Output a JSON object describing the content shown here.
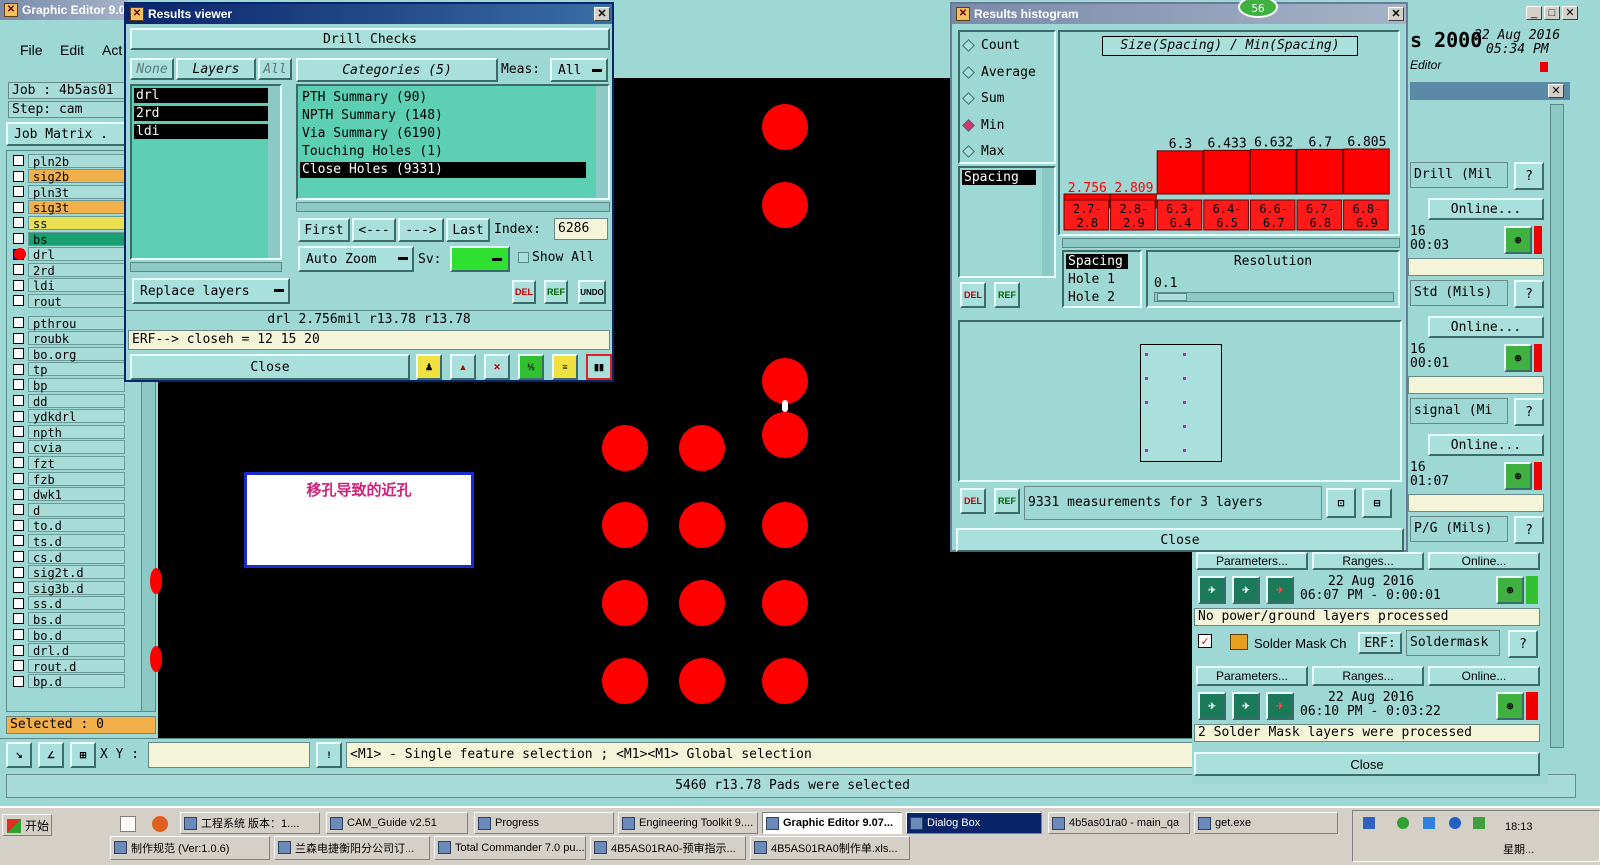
{
  "main_window": {
    "title": "Graphic Editor 9.0",
    "menu": [
      "File",
      "Edit",
      "Act"
    ],
    "job": "Job : 4b5as01",
    "step": "Step: cam",
    "job_matrix": "Job Matrix ."
  },
  "layer_list": [
    {
      "name": "pln2b",
      "color": "#a8dcd8"
    },
    {
      "name": "sig2b",
      "color": "#f2b04a"
    },
    {
      "name": "pln3t",
      "color": "#a8dcd8"
    },
    {
      "name": "sig3t",
      "color": "#f2b04a"
    },
    {
      "name": "ss",
      "color": "#e8e050"
    },
    {
      "name": "bs",
      "color": "#18a070"
    },
    {
      "name": "drl",
      "color": "#a8dcd8"
    },
    {
      "name": "2rd",
      "color": "#a8dcd8"
    },
    {
      "name": "ldi",
      "color": "#a8dcd8"
    },
    {
      "name": "rout",
      "color": "#a8dcd8"
    },
    {
      "name": "pthrou",
      "color": "#a8dcd8"
    },
    {
      "name": "roubk",
      "color": "#a8dcd8"
    },
    {
      "name": "bo.org",
      "color": "#a8dcd8"
    },
    {
      "name": "tp",
      "color": "#a8dcd8"
    },
    {
      "name": "bp",
      "color": "#a8dcd8"
    },
    {
      "name": "dd",
      "color": "#a8dcd8"
    },
    {
      "name": "ydkdrl",
      "color": "#a8dcd8"
    },
    {
      "name": "npth",
      "color": "#a8dcd8"
    },
    {
      "name": "cvia",
      "color": "#a8dcd8"
    },
    {
      "name": "fzt",
      "color": "#a8dcd8"
    },
    {
      "name": "fzb",
      "color": "#a8dcd8"
    },
    {
      "name": "dwk1",
      "color": "#a8dcd8"
    },
    {
      "name": "d",
      "color": "#a8dcd8"
    },
    {
      "name": "to.d",
      "color": "#a8dcd8"
    },
    {
      "name": "ts.d",
      "color": "#a8dcd8"
    },
    {
      "name": "cs.d",
      "color": "#a8dcd8"
    },
    {
      "name": "sig2t.d",
      "color": "#a8dcd8"
    },
    {
      "name": "sig3b.d",
      "color": "#a8dcd8"
    },
    {
      "name": "ss.d",
      "color": "#a8dcd8"
    },
    {
      "name": "bs.d",
      "color": "#a8dcd8"
    },
    {
      "name": "bo.d",
      "color": "#a8dcd8"
    },
    {
      "name": "drl.d",
      "color": "#a8dcd8"
    },
    {
      "name": "rout.d",
      "color": "#a8dcd8"
    },
    {
      "name": "bp.d",
      "color": "#a8dcd8"
    }
  ],
  "selected_count": "Selected : 0",
  "xy_label": "X Y :",
  "status_hint": "<M1> - Single feature selection ; <M1><M1> Global selection",
  "status_bottom": "5460 r13.78 Pads were selected",
  "annotation_text": "移孔导致的近孔",
  "results_viewer": {
    "title": "Results viewer",
    "header": "Drill Checks",
    "layer_filters": [
      "None",
      "Layers",
      "All"
    ],
    "layers": [
      "drl",
      "2rd",
      "ldi"
    ],
    "categories_label": "Categories (5)",
    "meas_label": "Meas:",
    "meas_value": "All",
    "categories": [
      "PTH Summary (90)",
      "NPTH Summary (148)",
      "Via Summary (6190)",
      "Touching Holes (1)",
      "Close Holes (9331)"
    ],
    "selected_category": "Close Holes (9331)",
    "nav": {
      "first": "First",
      "prev": "<---",
      "next": "--->",
      "last": "Last",
      "index_label": "Index:",
      "index_value": "6286"
    },
    "auto_zoom": "Auto Zoom",
    "sv_label": "Sv:",
    "show_all": "Show All",
    "replace_layers": "Replace layers",
    "icon_del": "DEL",
    "icon_ref": "REF",
    "icon_undo": "UNDO",
    "measure_line": "drl 2.756mil   r13.78   r13.78",
    "erf_line": "ERF--> closeh = 12 15 20",
    "close": "Close"
  },
  "histogram": {
    "title": "Results histogram",
    "badge": "56",
    "modes": [
      "Count",
      "Average",
      "Sum",
      "Min",
      "Max"
    ],
    "selected_mode": "Min",
    "list_item": "Spacing",
    "chart_title": "Size(Spacing) / Min(Spacing)",
    "info_items": [
      "Spacing",
      "Hole 1",
      "Hole 2"
    ],
    "resolution_label": "Resolution",
    "resolution_value": "0.1",
    "measurements": "9331 measurements for 3 layers",
    "close": "Close"
  },
  "chart_data": {
    "type": "bar",
    "title": "Size(Spacing) / Min(Spacing)",
    "categories": [
      "2.7-2.8",
      "2.8-2.9",
      "6.3-6.4",
      "6.4-6.5",
      "6.6-6.7",
      "6.7-6.8",
      "6.8-6.9"
    ],
    "values": [
      2.756,
      2.809,
      6.3,
      6.433,
      6.632,
      6.7,
      6.805
    ],
    "value_labels": [
      "2.756",
      "2.809",
      "6.3",
      "6.433",
      "6.632",
      "6.7",
      "6.805"
    ],
    "ylim": [
      0,
      12
    ]
  },
  "right_panel": {
    "title_right": "s 2000",
    "date": "22 Aug 2016",
    "time": "05:34 PM",
    "editor_label": "Editor",
    "rows": [
      {
        "field": "Drill (Mil",
        "online": "Online...",
        "time": "00:03"
      },
      {
        "field": "Std (Mils)",
        "online": "Online...",
        "time": "00:01"
      },
      {
        "field": "signal (Mi",
        "online": "Online...",
        "time": "01:07"
      },
      {
        "field": "P/G (Mils)",
        "online": "",
        "time": ""
      }
    ],
    "day_fragment": "16",
    "params": "Parameters...",
    "ranges": "Ranges...",
    "online": "Online...",
    "pg_date": "22 Aug 2016",
    "pg_time": "06:07 PM - 0:00:01",
    "pg_msg": "No power/ground layers processed",
    "sm_label": "Solder Mask Ch",
    "sm_erf": "ERF:",
    "sm_erf_value": "Soldermask",
    "sm_date": "22 Aug 2016",
    "sm_time": "06:10 PM - 0:03:22",
    "sm_msg": "2 Solder Mask layers were processed",
    "close": "Close"
  },
  "taskbar": {
    "start": "开始",
    "tasks": [
      "工程系统  版本：1....",
      "CAM_Guide v2.51",
      "Progress",
      "Engineering Toolkit 9....",
      "Graphic Editor 9.07...",
      "Dialog Box",
      "4b5as01ra0 - main_qa",
      "get.exe"
    ],
    "tasks_row2": [
      "制作规范 (Ver:1.0.6)",
      "兰森电捷衡阳分公司订...",
      "Total Commander 7.0 pu...",
      "4B5AS01RA0-预审指示...",
      "4B5AS01RA0制作单.xls..."
    ],
    "clock": "18:13",
    "clock_day": "星期..."
  },
  "colors": {
    "cyan_bg": "#9ed8d4",
    "hole_red": "#ff0000",
    "canvas_black": "#000000",
    "annotation_magenta": "#d0207a"
  }
}
